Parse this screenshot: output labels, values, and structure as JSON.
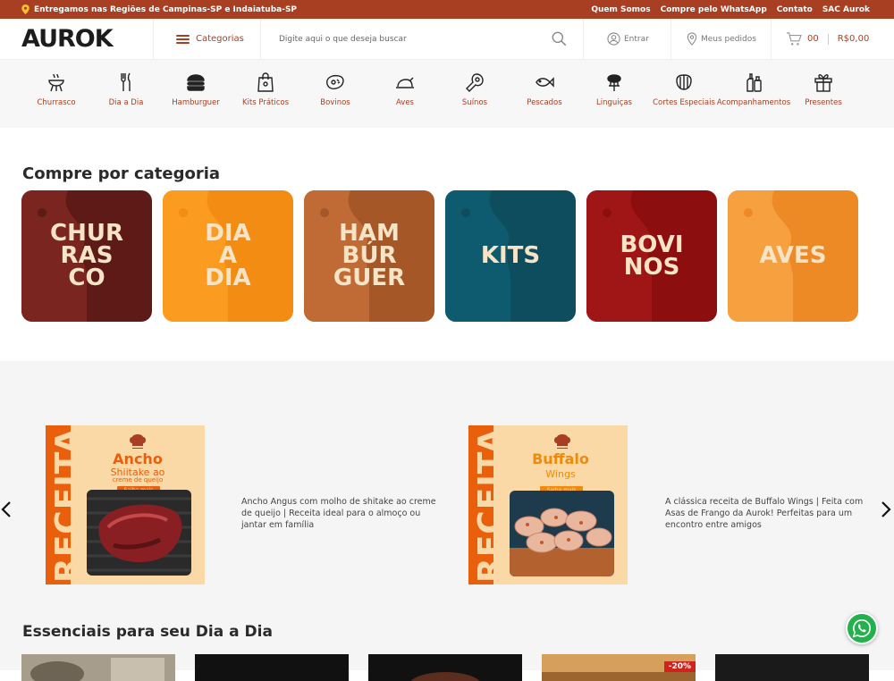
{
  "topbar": {
    "delivery_text": "Entregamos nas Regiões de Campinas-SP e Indaiatuba-SP",
    "links": [
      "Quem Somos",
      "Compre pelo WhatsApp",
      "Contato",
      "SAC Aurok"
    ]
  },
  "header": {
    "logo": "AUROK",
    "categories_label": "Categorias",
    "search_placeholder": "Digite aqui o que deseja buscar",
    "login_label": "Entrar",
    "orders_label": "Meus pedidos",
    "cart_count": "00",
    "cart_total": "R$0,00"
  },
  "catnav": [
    {
      "label": "Churrasco",
      "icon": "grill-icon"
    },
    {
      "label": "Dia a Dia",
      "icon": "cutlery-icon"
    },
    {
      "label": "Hamburguer",
      "icon": "burger-icon"
    },
    {
      "label": "Kits Práticos",
      "icon": "bag-icon"
    },
    {
      "label": "Bovinos",
      "icon": "steak-icon"
    },
    {
      "label": "Aves",
      "icon": "chicken-icon"
    },
    {
      "label": "Suínos",
      "icon": "ham-icon"
    },
    {
      "label": "Pescados",
      "icon": "fish-icon"
    },
    {
      "label": "Linguiças",
      "icon": "sausage-icon"
    },
    {
      "label": "Cortes Especiais",
      "icon": "ribs-icon"
    },
    {
      "label": "Acompanhamentos",
      "icon": "bottles-icon"
    },
    {
      "label": "Presentes",
      "icon": "gift-icon"
    }
  ],
  "section_category": "Compre por categoria",
  "category_cards": [
    {
      "label": "CHUR\nRAS\nCO",
      "bg": "#5e1a16",
      "shade": "#7a2520"
    },
    {
      "label": "DIA\nA\nDIA",
      "bg": "#f28c12",
      "shade": "#fb9b20"
    },
    {
      "label": "HAM\nBÚR\nGUER",
      "bg": "#a55728",
      "shade": "#c06a35"
    },
    {
      "label": "KITS",
      "bg": "#0d4d5e",
      "shade": "#0e5b6f"
    },
    {
      "label": "BOVI\nNOS",
      "bg": "#8c0e0e",
      "shade": "#a01616"
    },
    {
      "label": "AVES",
      "bg": "#ee8a25",
      "shade": "#f7a040"
    }
  ],
  "recipes": [
    {
      "vertical": "RECEITA",
      "title": "Ancho",
      "subtitle": "Shiitake ao",
      "subtitle2": "creme de queijo",
      "button": "Saiba mais",
      "description": "Ancho Angus com molho de shitake ao creme de queijo | Receita ideal para o almoço ou jantar em família"
    },
    {
      "vertical": "RECEITA",
      "title": "Buffalo",
      "subtitle": "Wings",
      "subtitle2": "",
      "button": "Saiba mais",
      "description": "A clássica receita de Buffalo Wings | Feita com Asas de Frango da Aurok! Perfeitas para um encontro entre amigos"
    }
  ],
  "section_essentials": "Essenciais para seu Dia a Dia",
  "product_badge": "-20%",
  "colors": {
    "brand": "#a93f22",
    "recipe_orange": "#e95f0c",
    "recipe_bg": "#fbd9a6",
    "whatsapp": "#22b14c"
  }
}
